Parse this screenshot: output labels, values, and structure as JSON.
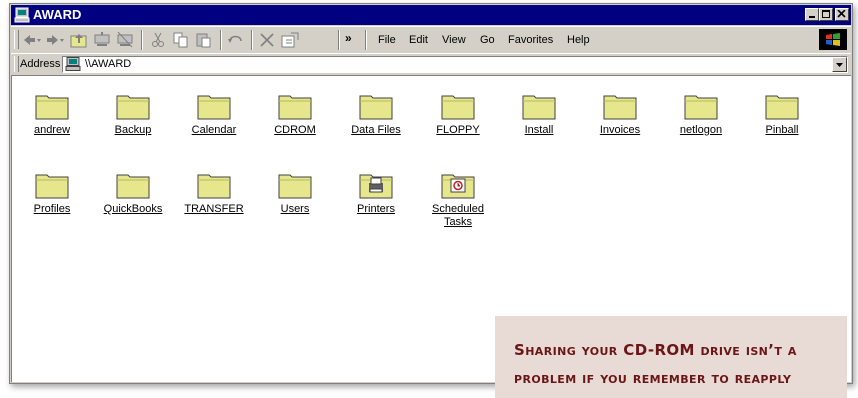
{
  "window": {
    "title": "AWARD",
    "icon": "computer-icon",
    "controls": [
      "minimize-icon",
      "maximize-icon",
      "close-icon"
    ]
  },
  "toolbar": {
    "buttons": [
      {
        "name": "back",
        "icon": "back-arrow-icon"
      },
      {
        "name": "forward",
        "icon": "forward-arrow-icon"
      },
      {
        "name": "up",
        "icon": "up-folder-icon"
      },
      {
        "name": "map-drive",
        "icon": "map-drive-icon"
      },
      {
        "name": "disconnect",
        "icon": "disconnect-drive-icon"
      },
      {
        "name": "cut",
        "icon": "scissors-icon"
      },
      {
        "name": "copy",
        "icon": "copy-icon"
      },
      {
        "name": "paste",
        "icon": "paste-icon"
      },
      {
        "name": "undo",
        "icon": "undo-icon"
      },
      {
        "name": "delete",
        "icon": "delete-icon"
      },
      {
        "name": "properties",
        "icon": "properties-icon"
      }
    ],
    "overflow": "»",
    "menu": [
      "File",
      "Edit",
      "View",
      "Go",
      "Favorites",
      "Help"
    ],
    "logo": "windows-logo-icon"
  },
  "address": {
    "label": "Address",
    "value": "\\\\AWARD"
  },
  "items": [
    {
      "label": "andrew",
      "icon": "folder-icon"
    },
    {
      "label": "Backup",
      "icon": "folder-icon"
    },
    {
      "label": "Calendar",
      "icon": "folder-icon"
    },
    {
      "label": "CDROM",
      "icon": "folder-icon"
    },
    {
      "label": "Data Files",
      "icon": "folder-icon"
    },
    {
      "label": "FLOPPY",
      "icon": "folder-icon"
    },
    {
      "label": "Install",
      "icon": "folder-icon"
    },
    {
      "label": "Invoices",
      "icon": "folder-icon"
    },
    {
      "label": "netlogon",
      "icon": "folder-icon"
    },
    {
      "label": "Pinball",
      "icon": "folder-icon"
    },
    {
      "label": "Profiles",
      "icon": "folder-icon"
    },
    {
      "label": "QuickBooks",
      "icon": "folder-icon"
    },
    {
      "label": "TRANSFER",
      "icon": "folder-icon"
    },
    {
      "label": "Users",
      "icon": "folder-icon"
    },
    {
      "label": "Printers",
      "icon": "printers-folder-icon"
    },
    {
      "label": "Scheduled Tasks",
      "icon": "scheduled-tasks-folder-icon"
    }
  ],
  "caption": {
    "line1": "Sharing your CD-ROM drive isn’t a",
    "line2": "problem if you remember to reapply"
  },
  "colors": {
    "titlebar": "#000080",
    "window_face": "#d4d0c8",
    "folder_fill": "#e6e68c",
    "caption_bg": "#e8dad4",
    "caption_text": "#6b1616"
  }
}
